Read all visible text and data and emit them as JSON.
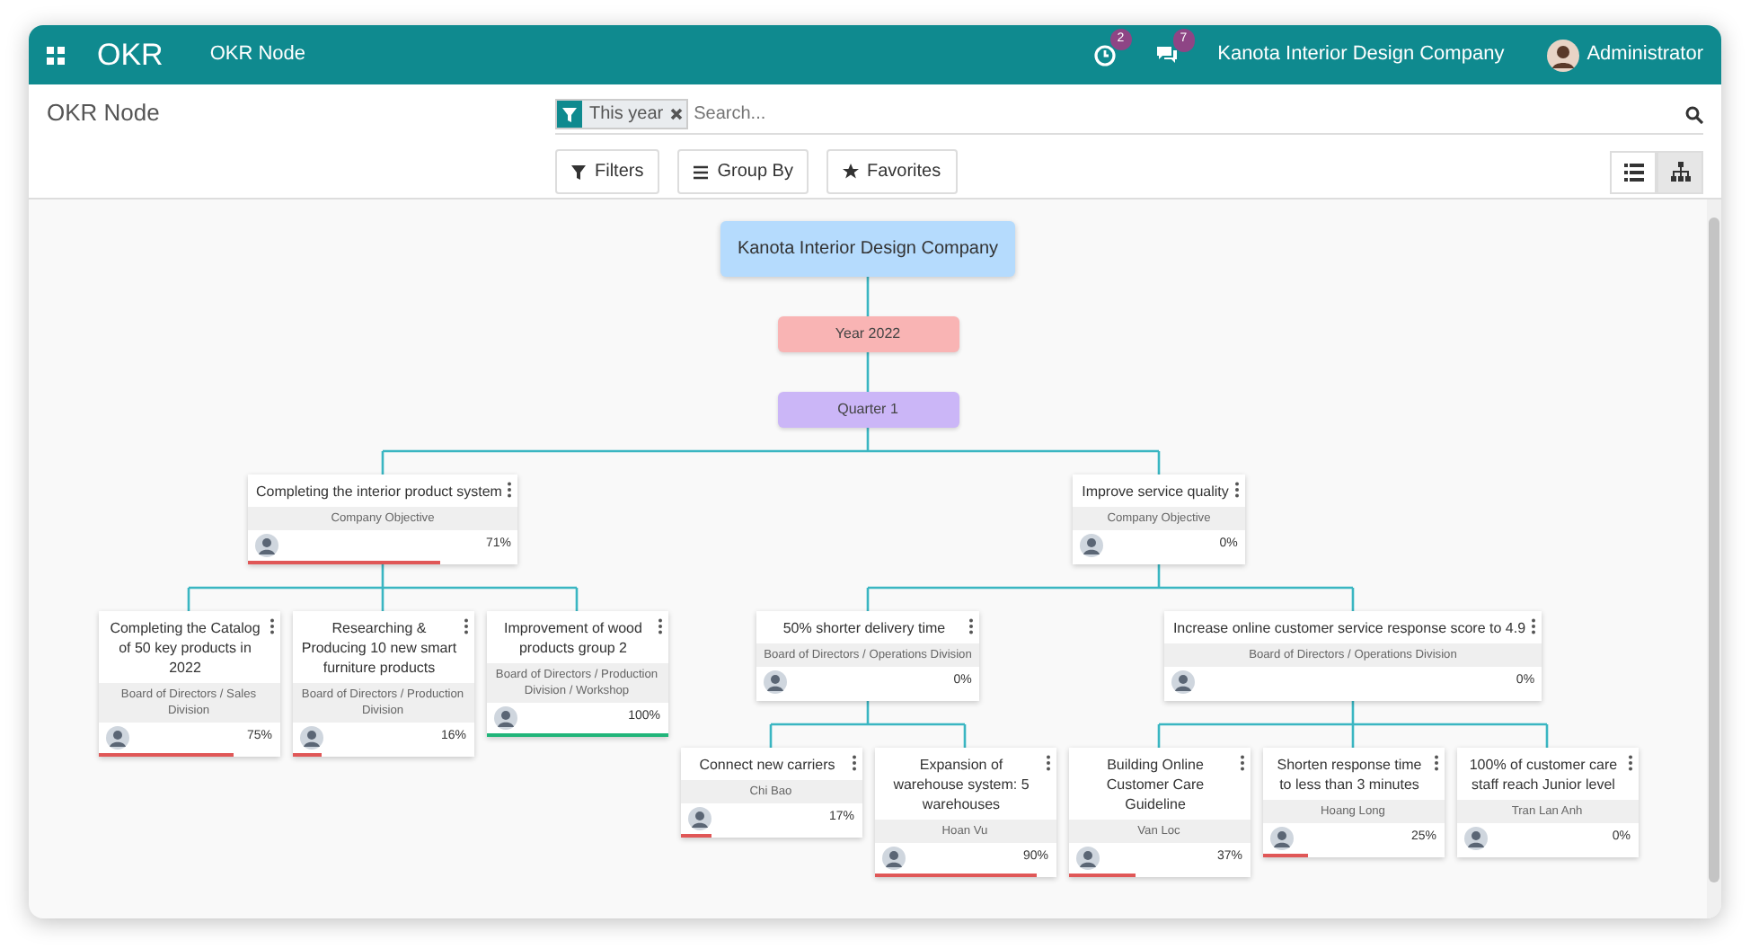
{
  "navbar": {
    "app_name": "OKR",
    "menu": [
      {
        "label": "OKR Node"
      }
    ],
    "activity_badge": "2",
    "messages_badge": "7",
    "company": "Kanota Interior Design Company",
    "user": "Administrator"
  },
  "control_panel": {
    "title": "OKR Node",
    "facets": [
      {
        "label": "This year"
      }
    ],
    "search": {
      "placeholder": "Search..."
    },
    "buttons": [
      {
        "label": "Filters",
        "kind": "filter"
      },
      {
        "label": "Group By",
        "kind": "group"
      },
      {
        "label": "Favorites",
        "kind": "star"
      }
    ],
    "views": [
      {
        "kind": "list",
        "selected": false
      },
      {
        "kind": "hierarchy",
        "selected": true
      }
    ]
  },
  "tree": {
    "kind": "company",
    "label": "Kanota Interior Design Company",
    "children": [
      {
        "kind": "year",
        "label": "Year 2022",
        "children": [
          {
            "kind": "quarter",
            "label": "Quarter 1",
            "children": [
              {
                "kind": "objective",
                "title": "Completing the interior product system",
                "subtitle": "Company Objective",
                "progress": "71%",
                "level": 0.71,
                "children": [
                  {
                    "kind": "objective",
                    "title": "Completing the Catalog of 50 key products in 2022",
                    "subtitle": "Board of Directors / Sales Division",
                    "progress": "75%",
                    "level": 0.75
                  },
                  {
                    "kind": "objective",
                    "title": "Researching & Producing 10 new smart furniture products",
                    "subtitle": "Board of Directors / Production Division",
                    "progress": "16%",
                    "level": 0.16
                  },
                  {
                    "kind": "objective",
                    "title": "Improvement of wood products group 2",
                    "subtitle": "Board of Directors / Production Division / Workshop",
                    "progress": "100%",
                    "level": 1
                  }
                ]
              },
              {
                "kind": "objective",
                "title": "Improve service quality",
                "subtitle": "Company Objective",
                "progress": "0%",
                "level": 0,
                "children": [
                  {
                    "kind": "objective",
                    "title": "50% shorter delivery time",
                    "subtitle": "Board of Directors / Operations Division",
                    "progress": "0%",
                    "level": 0,
                    "children": [
                      {
                        "kind": "objective",
                        "title": "Connect new carriers",
                        "subtitle": "Chi Bao",
                        "progress": "17%",
                        "level": 0.17
                      },
                      {
                        "kind": "objective",
                        "title": "Expansion of warehouse system: 5 warehouses",
                        "subtitle": "Hoan Vu",
                        "progress": "90%",
                        "level": 0.9
                      }
                    ]
                  },
                  {
                    "kind": "objective",
                    "title": "Increase online customer service response score to 4.9",
                    "subtitle": "Board of Directors / Operations Division",
                    "progress": "0%",
                    "level": 0,
                    "children": [
                      {
                        "kind": "objective",
                        "title": "Building Online Customer Care Guideline",
                        "subtitle": "Van Loc",
                        "progress": "37%",
                        "level": 0.37
                      },
                      {
                        "kind": "objective",
                        "title": "Shorten response time to less than 3 minutes",
                        "subtitle": "Hoang Long",
                        "progress": "25%",
                        "level": 0.25
                      },
                      {
                        "kind": "objective",
                        "title": "100% of customer care staff reach Junior level",
                        "subtitle": "Tran Lan Anh",
                        "progress": "0%",
                        "level": 0
                      }
                    ]
                  }
                ]
              }
            ]
          }
        ]
      }
    ]
  }
}
